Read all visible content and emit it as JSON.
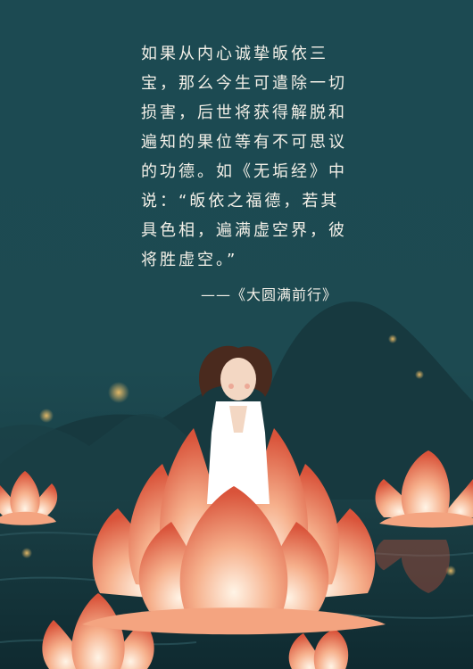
{
  "quote": {
    "lines": [
      "如果从内心诚挚皈依三",
      "宝，那么今生可遣除一切",
      "损害，后世将获得解脱和",
      "遍知的果位等有不可思议",
      "的功德。如《无垢经》中",
      "说：“皈依之福德，若其",
      "具色相，遍满虚空界，彼",
      "将胜虚空。”"
    ],
    "source": "——《大圆满前行》"
  },
  "colors": {
    "background": "#1d4a51",
    "mountain": "#17393f",
    "water": "#133137",
    "lotus_petal": "#f08b6a",
    "lotus_tip": "#d9533a",
    "text": "#f3f0e8"
  },
  "illustration": {
    "figure": "woman-praying-icon",
    "flowers": [
      "lotus-icon"
    ]
  }
}
